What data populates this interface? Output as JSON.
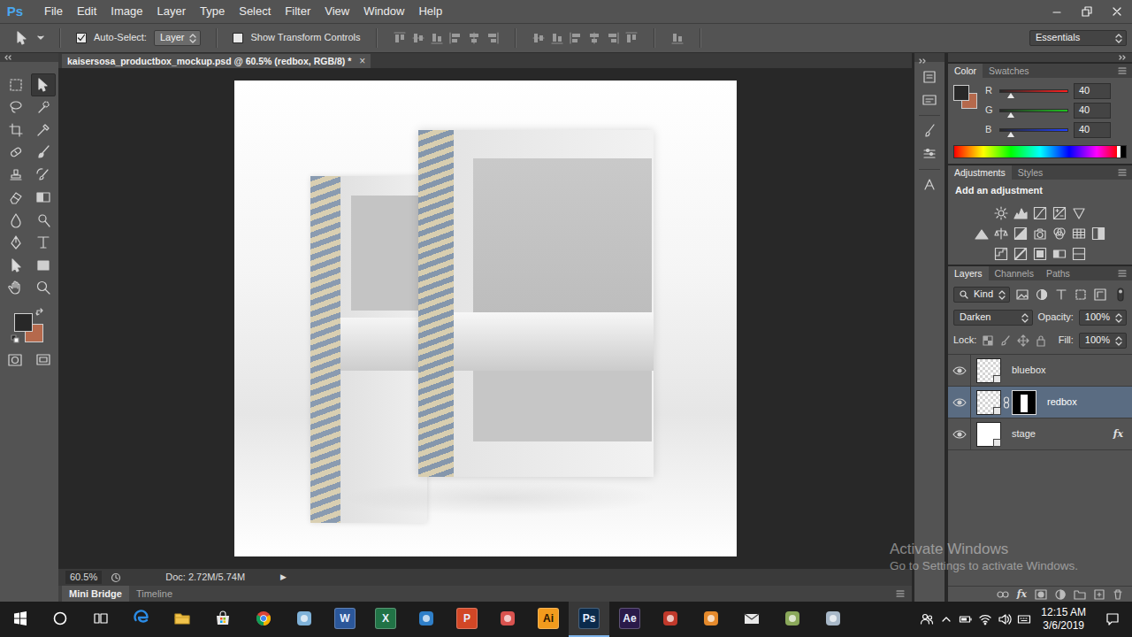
{
  "app": {
    "logo": "Ps"
  },
  "menu": [
    "File",
    "Edit",
    "Image",
    "Layer",
    "Type",
    "Select",
    "Filter",
    "View",
    "Window",
    "Help"
  ],
  "options_bar": {
    "auto_select": {
      "label": "Auto-Select:",
      "checked": true
    },
    "auto_select_target": "Layer",
    "show_transform_controls": {
      "label": "Show Transform Controls",
      "checked": false
    },
    "workspace": "Essentials"
  },
  "tools": [
    {
      "selected": false
    },
    {
      "selected": true
    },
    {
      "selected": false
    },
    {
      "selected": false
    },
    {
      "selected": false
    },
    {
      "selected": false
    },
    {
      "selected": false
    },
    {
      "selected": false
    },
    {
      "selected": false
    },
    {
      "selected": false
    },
    {
      "selected": false
    },
    {
      "selected": false
    },
    {
      "selected": false
    },
    {
      "selected": false
    },
    {
      "selected": false
    },
    {
      "selected": false
    },
    {
      "selected": false
    },
    {
      "selected": false
    },
    {
      "selected": false
    },
    {
      "selected": false
    }
  ],
  "swatches": {
    "foreground": "#282828",
    "background": "#b5694c"
  },
  "document": {
    "tab": "kaisersosa_productbox_mockup.psd @ 60.5% (redbox, RGB/8) *",
    "close": "×"
  },
  "status_bar": {
    "zoom": "60.5%",
    "doc": "Doc: 2.72M/5.74M",
    "arrow": "▶"
  },
  "bottom_tabs": [
    {
      "label": "Mini Bridge",
      "selected": true
    },
    {
      "label": "Timeline",
      "selected": false
    }
  ],
  "color_panel": {
    "tabs": [
      {
        "label": "Color",
        "selected": true
      },
      {
        "label": "Swatches",
        "selected": false
      }
    ],
    "channels": [
      {
        "name": "R",
        "value": "40",
        "level": 0.157,
        "color": "#ff2020"
      },
      {
        "name": "G",
        "value": "40",
        "level": 0.157,
        "color": "#20c020"
      },
      {
        "name": "B",
        "value": "40",
        "level": 0.157,
        "color": "#2040ff"
      }
    ]
  },
  "adjustments_panel": {
    "tabs": [
      {
        "label": "Adjustments",
        "selected": true
      },
      {
        "label": "Styles",
        "selected": false
      }
    ],
    "hint": "Add an adjustment"
  },
  "layers_panel": {
    "tabs": [
      {
        "label": "Layers",
        "selected": true
      },
      {
        "label": "Channels",
        "selected": false
      },
      {
        "label": "Paths",
        "selected": false
      }
    ],
    "filter": "Kind",
    "blend_mode": "Darken",
    "opacity_label": "Opacity:",
    "opacity": "100%",
    "lock_label": "Lock:",
    "fill_label": "Fill:",
    "fill": "100%",
    "fx_glyph": "fx",
    "footer_fx": "fx",
    "layers": [
      {
        "name": "bluebox",
        "kind": "transparent",
        "visible": true,
        "selected": false,
        "mask": false,
        "effects": false
      },
      {
        "name": "redbox",
        "kind": "transparent",
        "visible": true,
        "selected": true,
        "mask": true,
        "effects": false
      },
      {
        "name": "stage",
        "kind": "opaque",
        "visible": true,
        "selected": false,
        "mask": false,
        "effects": true
      }
    ]
  },
  "watermark": {
    "title": "Activate Windows",
    "subtitle": "Go to Settings to activate Windows."
  },
  "taskbar": {
    "apps": [
      {
        "kind": "edge",
        "selected": false
      },
      {
        "kind": "folder",
        "selected": false
      },
      {
        "kind": "store",
        "selected": false
      },
      {
        "kind": "chrome",
        "selected": false
      },
      {
        "kind": "glyph",
        "color": "#7fb2d9",
        "selected": false
      },
      {
        "kind": "tile",
        "label": "W",
        "color": "#2b579a",
        "selected": false
      },
      {
        "kind": "tile",
        "label": "X",
        "color": "#217346",
        "selected": false
      },
      {
        "kind": "glyph",
        "color": "#2f7fc8",
        "selected": false
      },
      {
        "kind": "tile",
        "label": "P",
        "color": "#d24726",
        "selected": false
      },
      {
        "kind": "glyph",
        "color": "#d9534f",
        "selected": false
      },
      {
        "kind": "tile",
        "label": "Ai",
        "color": "#f29b1d",
        "selected": false
      },
      {
        "kind": "tile",
        "label": "Ps",
        "color": "#0b2b4c",
        "selected": true
      },
      {
        "kind": "tile",
        "label": "Ae",
        "color": "#2a1a4a",
        "selected": false
      },
      {
        "kind": "glyph",
        "color": "#c0392b",
        "selected": false
      },
      {
        "kind": "glyph",
        "color": "#e58a2c",
        "selected": false
      },
      {
        "kind": "mail",
        "selected": false
      },
      {
        "kind": "glyph",
        "color": "#8aa85a",
        "selected": false
      },
      {
        "kind": "glyph",
        "color": "#a8b8c8",
        "selected": false
      }
    ],
    "time": "12:15 AM",
    "date": "3/6/2019"
  }
}
